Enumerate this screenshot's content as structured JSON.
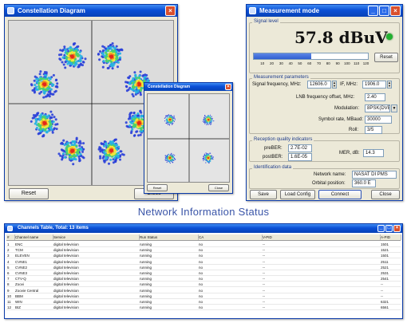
{
  "constellation": {
    "title": "Constellation Diagram",
    "reset_label": "Reset",
    "close_label": "Close"
  },
  "mini_constellation": {
    "title": "Constellation Diagram",
    "reset_label": "Reset",
    "close_label": "Close"
  },
  "measurement": {
    "title": "Measurement mode",
    "signal_level_heading": "Signal level",
    "signal_value": "57.8 dBuV",
    "signal_fill": 0.5,
    "reset_label": "Reset",
    "scale_ticks": [
      "10",
      "20",
      "30",
      "40",
      "50",
      "60",
      "70",
      "80",
      "90",
      "100",
      "110",
      "120"
    ],
    "params_heading": "Measurement parameters",
    "signal_freq_label": "Signal frequency, MHz:",
    "signal_freq_value": "12606.0",
    "if_label": "IF, MHz:",
    "if_value": "1906.0",
    "lnb_label": "LNB frequency offset, MHz:",
    "lnb_value": "2.40",
    "modulation_label": "Modulation:",
    "modulation_value": "8PSK(DVB-S2)",
    "symbol_label": "Symbol rate, MBaud:",
    "symbol_value": "30000",
    "roll_label": "Roll:",
    "roll_value": "3/5",
    "quality_heading": "Reception quality indicators",
    "prebfr_label": "preBER:",
    "prebfr_value": "2.7E-02",
    "postbfr_label": "postBER:",
    "postbfr_value": "1.6E-05",
    "mer_label": "MER, dB:",
    "mer_value": "14.3",
    "id_heading": "Identification data",
    "network_label": "Network name:",
    "network_value": "NASAT DI PMS",
    "orbital_label": "Orbital position:",
    "orbital_value": "360.0 E",
    "btn_save": "Save",
    "btn_loadconfig": "Load Config",
    "btn_connect": "Connect",
    "btn_close": "Close"
  },
  "caption": "Network Information Status",
  "channels": {
    "title": "Channels Table, Total: 13 items",
    "columns": [
      "#",
      "Channel name",
      "Service",
      "Run Status",
      "CA",
      "V-PID",
      "A-PID"
    ],
    "rows": [
      [
        "1",
        "ENC",
        "digital television",
        "running",
        "no",
        "--",
        "1501"
      ],
      [
        "2",
        "TCM",
        "digital television",
        "running",
        "no",
        "--",
        "1521"
      ],
      [
        "3",
        "ELEVEN",
        "digital television",
        "running",
        "no",
        "--",
        "1501"
      ],
      [
        "4",
        "CVNE1",
        "digital television",
        "running",
        "no",
        "--",
        "2511"
      ],
      [
        "5",
        "CVNE2",
        "digital television",
        "running",
        "no",
        "--",
        "2521"
      ],
      [
        "6",
        "CVNE3",
        "digital television",
        "running",
        "no",
        "--",
        "2531"
      ],
      [
        "7",
        "CTV-Q",
        "digital television",
        "running",
        "no",
        "--",
        "2541"
      ],
      [
        "8",
        "Zoovi",
        "digital television",
        "running",
        "no",
        "--",
        "--"
      ],
      [
        "9",
        "Zoovie Central",
        "digital television",
        "running",
        "no",
        "--",
        "--"
      ],
      [
        "10",
        "BBM",
        "digital television",
        "running",
        "no",
        "--",
        "--"
      ],
      [
        "11",
        "WIN",
        "digital television",
        "running",
        "no",
        "--",
        "6321"
      ],
      [
        "12",
        "BIZ",
        "digital television",
        "running",
        "no",
        "--",
        "6561"
      ]
    ]
  },
  "icons": {
    "minimize": "minimize-icon",
    "maximize": "maximize-icon",
    "close": "close-icon",
    "signal_led": "status-led-icon",
    "window": "window-icon"
  },
  "colors": {
    "titlebar": "#0a4fd6",
    "close_button": "#d9502d",
    "led": "#22b030",
    "bar_fill": "#2f5fd0",
    "caption": "#3a55a8"
  }
}
